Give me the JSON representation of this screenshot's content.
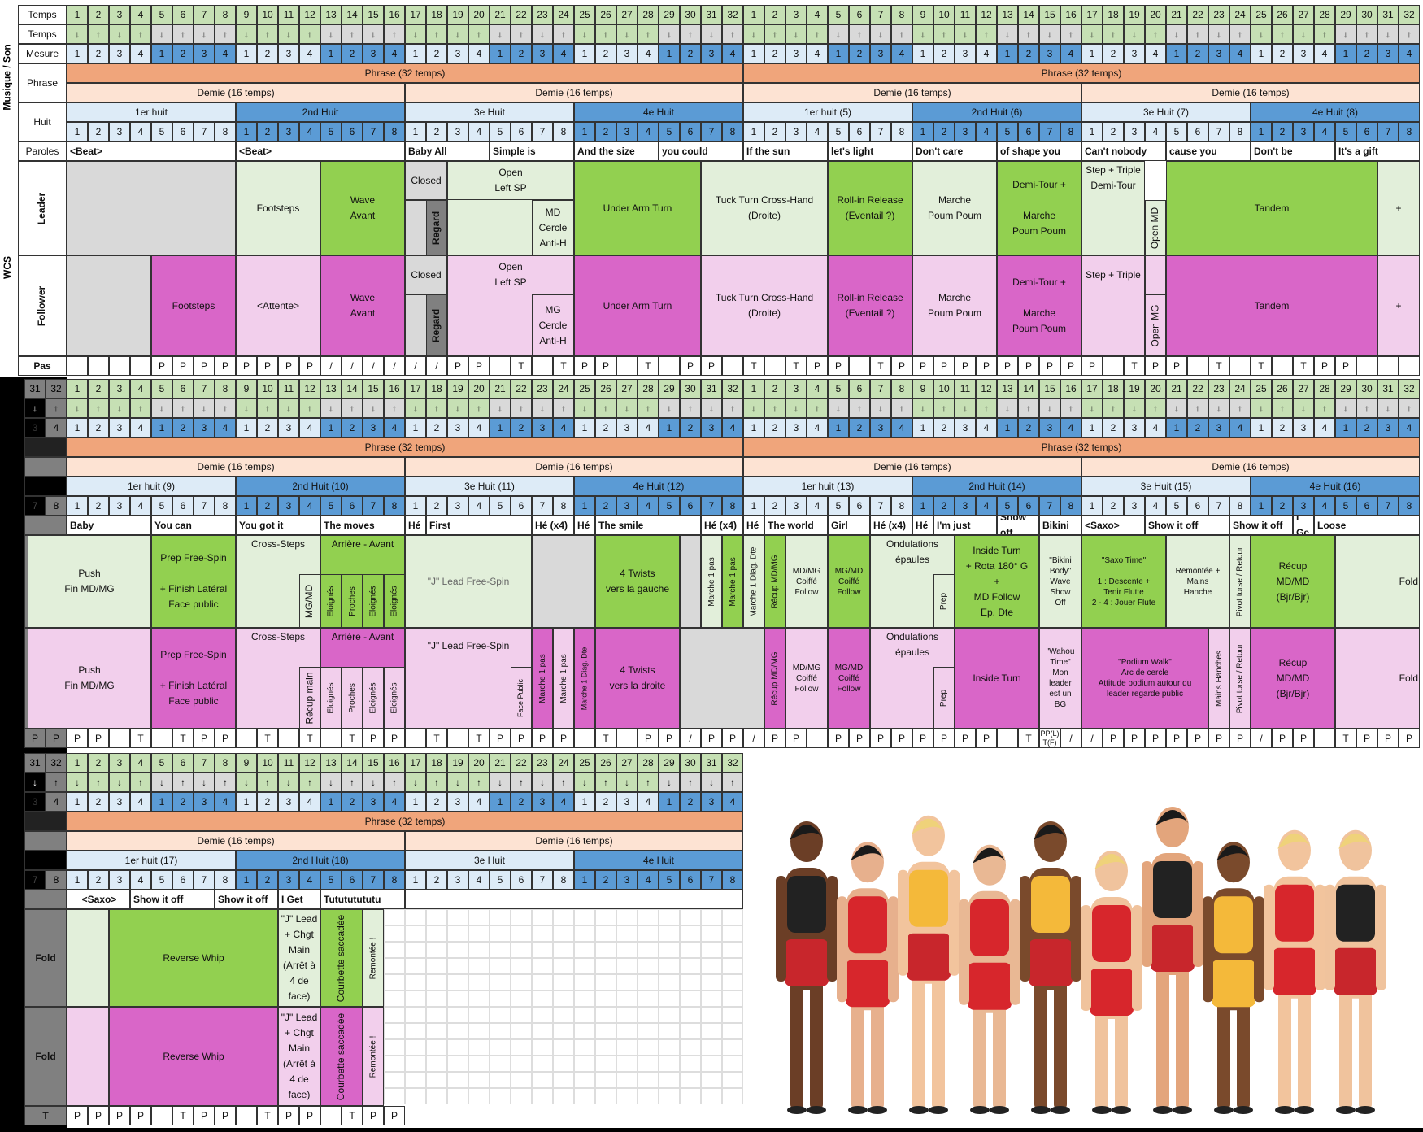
{
  "colors": {
    "tan": "#f0a57b",
    "peach": "#fde3d3",
    "lblue": "#ddebf7",
    "dblue": "#5b9bd5",
    "green": "#92d050",
    "lgreen": "#e2efda",
    "mgreen": "#c6e0b4",
    "grey": "#d9d9d9",
    "dgrey": "#808080",
    "magenta": "#d966c8",
    "lmag": "#f2cfec",
    "pink": "#e9b3e0",
    "white": "#ffffff",
    "hdr": "#c0c0c0"
  },
  "labels": {
    "musique": "Musique / Son",
    "wcs": "WCS",
    "temps": "Temps",
    "mesure": "Mesure",
    "phrase": "Phrase",
    "huit": "Huit",
    "paroles": "Paroles",
    "leader": "Leader",
    "follower": "Follower",
    "pas": "Pas"
  },
  "texts": {
    "phrase32": "Phrase (32 temps)",
    "demie16": "Demie (16 temps)",
    "s1": {
      "huits": [
        "1er huit",
        "2nd Huit",
        "3e Huit",
        "4e Huit",
        "1er huit (5)",
        "2nd Huit (6)",
        "3e Huit (7)",
        "4e Huit (8)"
      ],
      "paroles": [
        "<Beat>",
        "<Beat>",
        "Baby All",
        "Simple is",
        "And the size",
        "you could",
        "If the sun",
        "let's light",
        "Don't care",
        "of shape you",
        "Can't nobody",
        "cause you",
        "Don't be",
        "It's a gift"
      ],
      "leader": [
        "Footsteps",
        "Wave\nAvant",
        "Closed",
        "Regard",
        "Open\nLeft SP",
        "MD\nCercle\nAnti-H",
        "Under Arm Turn",
        "Tuck Turn Cross-Hand\n(Droite)",
        "Roll-in Release\n(Eventail ?)",
        "Marche\nPoum Poum",
        "Demi-Tour +\n\nMarche\nPoum Poum",
        "Step + Triple\nDemi-Tour",
        "Open MD",
        "Tandem",
        "+"
      ],
      "follower": [
        "Footsteps",
        "<Attente>",
        "Wave\nAvant",
        "Closed",
        "Regard",
        "Open\nLeft SP",
        "MG\nCercle\nAnti-H",
        "Under Arm Turn",
        "Tuck Turn Cross-Hand\n(Droite)",
        "Roll-in Release\n(Eventail ?)",
        "Marche\nPoum Poum",
        "Demi-Tour +\n\nMarche\nPoum Poum",
        "Step + Triple",
        "Open MG",
        "Tandem",
        "+"
      ]
    },
    "s2": {
      "huits": [
        "1er huit (9)",
        "2nd Huit (10)",
        "3e Huit (11)",
        "4e Huit (12)",
        "1er huit (13)",
        "2nd Huit (14)",
        "3e Huit (15)",
        "4e Huit (16)"
      ],
      "paroles": [
        "Baby",
        "You can",
        "You got it",
        "The moves",
        "Hé",
        "First",
        "Hé (x4)",
        "Hé",
        "The smile",
        "Hé (x4)",
        "Hé",
        "The world",
        "Girl",
        "Hé (x4)",
        "Hé",
        "I'm just",
        "Show off",
        "Bikini",
        "<Saxo>",
        "Show it off",
        "Show it off",
        "I Ge",
        "Loose"
      ],
      "leader": [
        "+",
        "Push\nFin MD/MG",
        "Prep Free-Spin\n\n+ Finish Latéral\nFace public",
        "Cross-Steps",
        "Arrière - Avant",
        "MG/MD",
        "Eloignés",
        "Proches",
        "Eloignés",
        "Eloignés",
        "\"J\" Lead Free-Spin",
        "4 Twists\nvers la gauche",
        "Marche 1 pas",
        "Marche 1 pas",
        "Marche 1 Diag. Dte",
        "Récup MD/MG",
        "MD/MG\nCoiffé\nFollow",
        "MG/MD\nCoiffé\nFollow",
        "Ondulations\népaules",
        "Prep",
        "Inside Turn\n+ Rota 180° G\n+\nMD Follow\nEp. Dte",
        "\"Bikini\nBody\"",
        "Wave\nShow\nOff",
        "\"Saxo Time\"",
        "1 : Descente +\nTenir Flutte\n2 - 4 : Jouer Flute",
        "Remontée +\nMains\nHanche",
        "Pivot torse / Retour",
        "Récup\nMD/MD\n(Bjr/Bjr)",
        "Fold"
      ],
      "follower": [
        "+",
        "Push\nFin MD/MG",
        "Prep Free-Spin\n\n+ Finish Latéral\nFace public",
        "Cross-Steps",
        "Arrière - Avant",
        "Récup main",
        "Eloignés",
        "Proches",
        "Eloignés",
        "Eloignés",
        "\"J\" Lead Free-Spin",
        "Face Public",
        "Marche 1 pas",
        "Marche 1 pas",
        "Marche 1 Diag. Dte",
        "4 Twists\nvers la droite",
        "Récup MD/MG",
        "MD/MG\nCoiffé\nFollow",
        "MG/MD\nCoiffé\nFollow",
        "Ondulations\népaules",
        "Prep",
        "Inside Turn",
        "\"Wahou\nTime\"",
        "Mon\nleader\nest un\nBG",
        "\"Podium Walk\"",
        "Arc de cercle\nAttitude podium  autour du\nleader regarde public",
        "Mains Hanches",
        "Pivot torse / Retour",
        "Récup\nMD/MD\n(Bjr/Bjr)",
        "Fold"
      ]
    },
    "s3": {
      "huits": [
        "1er huit (17)",
        "2nd Huit (18)",
        "3e Huit",
        "4e Huit"
      ],
      "paroles": [
        "<Saxo>",
        "Show it off",
        "Show it off",
        "I Get",
        "Tutututututu"
      ],
      "leader": [
        "Fold",
        "Reverse Whip",
        "\"J\" Lead\n+ Chgt\nMain\n(Arrêt à\n4 de\nface)",
        "Courbette\nsaccadée",
        "Remontée !"
      ],
      "follower": [
        "Fold",
        "Reverse Whip",
        "\"J\" Lead\n+ Chgt\nMain\n(Arrêt à\n4 de\nface)",
        "Courbette saccadée",
        "Remontée !"
      ]
    },
    "arrow_up": "↑",
    "arrow_down": "↓"
  },
  "pas": {
    "s1": [
      "",
      "",
      "",
      "",
      "P",
      "P",
      "P",
      "P",
      "P",
      "P",
      "P",
      "P",
      "/",
      "/",
      "/",
      "/",
      "/",
      "/",
      "P",
      "P",
      "",
      "T",
      "",
      "T",
      "P",
      "P",
      "",
      "T",
      "",
      "P",
      "P",
      "",
      "T",
      "",
      "T",
      "P",
      "P",
      "",
      "T",
      "P",
      "P",
      "P",
      "P",
      "P",
      "P",
      "P",
      "P",
      "P",
      "P",
      "",
      "T",
      "P",
      "P",
      "",
      "T",
      "",
      "T",
      "",
      "T",
      "P",
      "P"
    ],
    "s2": [
      "P",
      "P",
      "",
      "T",
      "",
      "T",
      "P",
      "P",
      "",
      "T",
      "",
      "T",
      "",
      "T",
      "P",
      "P",
      "",
      "T",
      "",
      "T",
      "P",
      "P",
      "P",
      "P",
      "",
      "T",
      "",
      "P",
      "P",
      "/",
      "P",
      "P",
      "/",
      "P",
      "P",
      "",
      "P",
      "P",
      "P",
      "P",
      "P",
      "P",
      "P",
      "P",
      "",
      "T",
      "PP(L) T(F)",
      "/",
      "/",
      "P",
      "P",
      "P",
      "P",
      "P",
      "P",
      "P",
      "/",
      "P",
      "P",
      "",
      "T",
      "P",
      "P",
      "P",
      "T"
    ],
    "s3": [
      "T",
      "P",
      "P",
      "P",
      "P",
      "",
      "T",
      "P",
      "P",
      "",
      "T",
      "P",
      "P",
      "",
      "T",
      "P",
      "P"
    ]
  }
}
